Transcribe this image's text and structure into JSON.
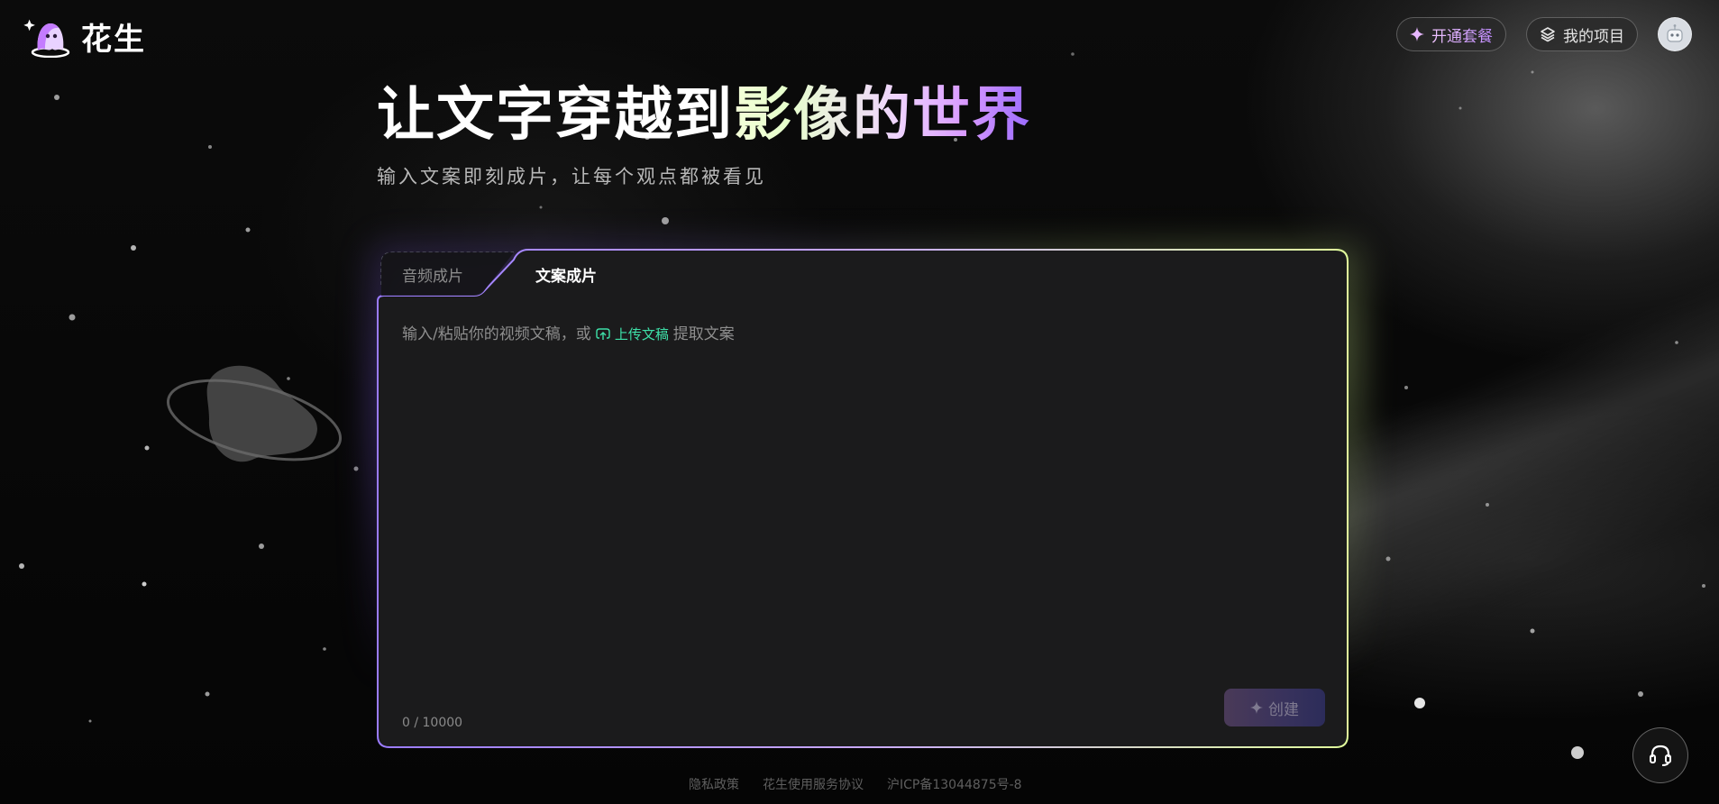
{
  "brand": {
    "name": "花生",
    "logo_icon": "ghost-mascot-icon"
  },
  "header": {
    "subscribe_label": "开通套餐",
    "subscribe_icon": "sparkle-icon",
    "projects_label": "我的项目",
    "projects_icon": "layers-icon",
    "avatar_icon": "robot-avatar-icon"
  },
  "hero": {
    "title_plain": "让文字穿越到",
    "title_gradient": "影像的世界",
    "subtitle": "输入文案即刻成片，让每个观点都被看见"
  },
  "card": {
    "tabs": [
      {
        "label": "音频成片",
        "active": false
      },
      {
        "label": "文案成片",
        "active": true
      }
    ],
    "placeholder_before": "输入/粘贴你的视频文稿，或",
    "upload_label": "上传文稿",
    "upload_icon": "cloud-upload-icon",
    "placeholder_after": "提取文案",
    "counter": "0 / 10000",
    "create_label": "创建",
    "create_icon": "sparkle-icon"
  },
  "footer": {
    "links": [
      "隐私政策",
      "花生使用服务协议",
      "沪ICP备13044875号-8"
    ]
  },
  "support": {
    "icon": "headset-icon"
  },
  "colors": {
    "accent_purple": "#9a7bff",
    "accent_lime": "#e2ff9c",
    "upload_green": "#3ee0a8"
  }
}
